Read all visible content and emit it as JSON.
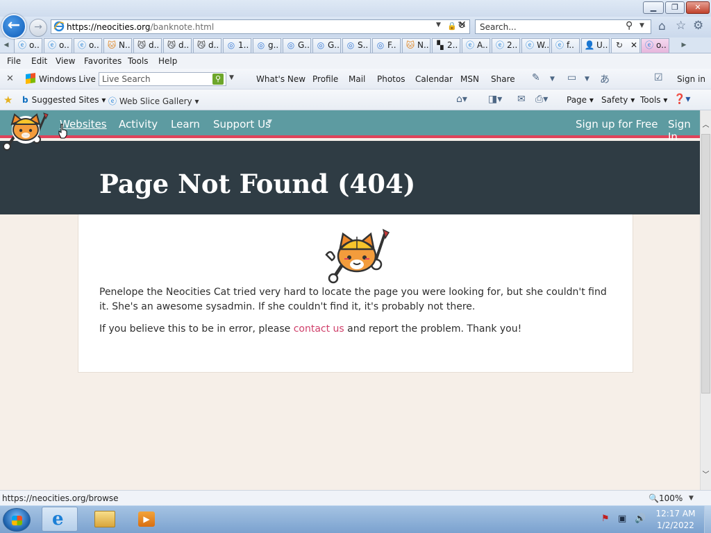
{
  "browser": {
    "address_host": "https://neocities.org",
    "address_path": "/banknote.html",
    "search_placeholder": "Search...",
    "tabs": [
      {
        "icon": "ie",
        "label": "o.."
      },
      {
        "icon": "ie",
        "label": "o.."
      },
      {
        "icon": "ie",
        "label": "o.."
      },
      {
        "icon": "cat",
        "label": "N.."
      },
      {
        "icon": "cat2",
        "label": "d.."
      },
      {
        "icon": "cat2",
        "label": "d.."
      },
      {
        "icon": "cat2",
        "label": "d.."
      },
      {
        "icon": "g",
        "label": "1.."
      },
      {
        "icon": "g",
        "label": "g.."
      },
      {
        "icon": "g",
        "label": "G.."
      },
      {
        "icon": "g",
        "label": "G.."
      },
      {
        "icon": "g",
        "label": "S.."
      },
      {
        "icon": "g",
        "label": "F.."
      },
      {
        "icon": "cat",
        "label": "N.."
      },
      {
        "icon": "sq",
        "label": "2.."
      },
      {
        "icon": "ie",
        "label": "A.."
      },
      {
        "icon": "ie",
        "label": "2.."
      },
      {
        "icon": "ie",
        "label": "W.."
      },
      {
        "icon": "ie",
        "label": "f.."
      },
      {
        "icon": "person",
        "label": "U.."
      },
      {
        "icon": "load",
        "label": ""
      },
      {
        "icon": "ie",
        "label": "o.."
      }
    ],
    "menu": [
      "File",
      "Edit",
      "View",
      "Favorites",
      "Tools",
      "Help"
    ],
    "windows_live": {
      "brand": "Windows Live",
      "search_placeholder": "Live Search",
      "links": [
        "What's New",
        "Profile",
        "Mail",
        "Photos",
        "Calendar",
        "MSN",
        "Share"
      ],
      "sign_in": "Sign in"
    },
    "favorites_bar": {
      "suggested": "Suggested Sites",
      "web_slice": "Web Slice Gallery"
    },
    "command_bar": [
      "Page",
      "Safety",
      "Tools"
    ],
    "status_url": "https://neocities.org/browse",
    "zoom": "100%"
  },
  "site": {
    "nav": {
      "websites": "Websites",
      "activity": "Activity",
      "learn": "Learn",
      "support": "Support Us",
      "signup": "Sign up for Free",
      "signin": "Sign In"
    },
    "hero_title": "Page Not Found (404)",
    "para1": "Penelope the Neocities Cat tried very hard to locate the page you were looking for, but she couldn't find it. She's an awesome sysadmin. If she couldn't find it, it's probably not there.",
    "para2_before": "If you believe this to be in error, please ",
    "para2_link": "contact us",
    "para2_after": " and report the problem. Thank you!",
    "colors": {
      "nav_bg": "#5d9ba1",
      "nav_accent": "#e0435a",
      "hero_bg": "#2f3c44",
      "page_bg": "#f6efe8",
      "link": "#d0406b"
    }
  },
  "taskbar": {
    "time": "12:17 AM",
    "date": "1/2/2022"
  }
}
